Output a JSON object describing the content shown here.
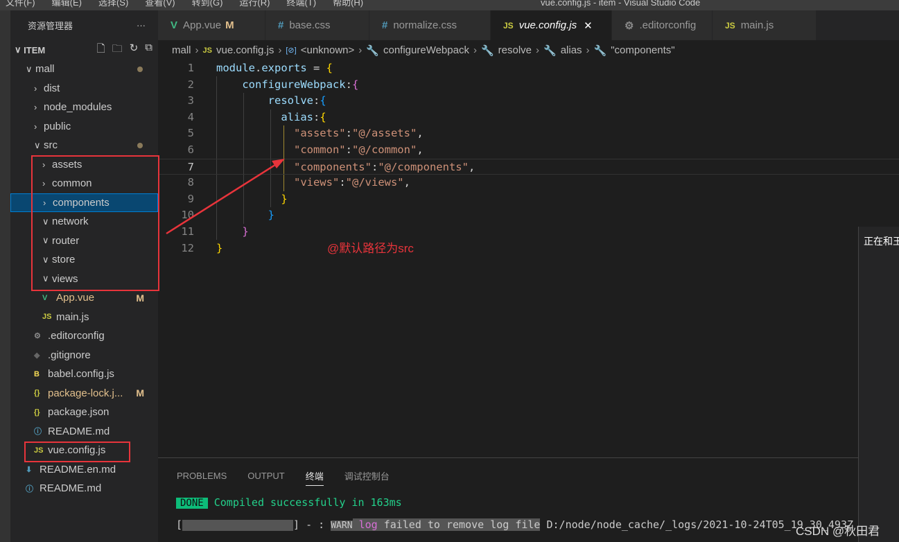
{
  "menubar": {
    "items": [
      "文件(F)",
      "编辑(E)",
      "选择(S)",
      "查看(V)",
      "转到(G)",
      "运行(R)",
      "终端(T)",
      "帮助(H)"
    ],
    "title": "vue.config.js - item - Visual Studio Code"
  },
  "sidebar": {
    "title": "资源管理器",
    "more": "···",
    "root": "ITEM",
    "items": [
      {
        "label": "mall",
        "type": "folder-open",
        "indent": 0,
        "dot": true
      },
      {
        "label": "dist",
        "type": "folder",
        "indent": 1
      },
      {
        "label": "node_modules",
        "type": "folder",
        "indent": 1
      },
      {
        "label": "public",
        "type": "folder",
        "indent": 1
      },
      {
        "label": "src",
        "type": "folder-open",
        "indent": 1,
        "dot": true
      },
      {
        "label": "assets",
        "type": "folder",
        "indent": 2
      },
      {
        "label": "common",
        "type": "folder",
        "indent": 2
      },
      {
        "label": "components",
        "type": "folder",
        "indent": 2,
        "selected": true
      },
      {
        "label": "network",
        "type": "folder-open",
        "indent": 2
      },
      {
        "label": "router",
        "type": "folder-open",
        "indent": 2
      },
      {
        "label": "store",
        "type": "folder-open",
        "indent": 2
      },
      {
        "label": "views",
        "type": "folder-open",
        "indent": 2
      },
      {
        "label": "App.vue",
        "type": "vue",
        "indent": 2,
        "badge": "M"
      },
      {
        "label": "main.js",
        "type": "js",
        "indent": 2
      },
      {
        "label": ".editorconfig",
        "type": "gear",
        "indent": 1
      },
      {
        "label": ".gitignore",
        "type": "git",
        "indent": 1
      },
      {
        "label": "babel.config.js",
        "type": "babel",
        "indent": 1
      },
      {
        "label": "package-lock.j...",
        "type": "json",
        "indent": 1,
        "badge": "M"
      },
      {
        "label": "package.json",
        "type": "json",
        "indent": 1
      },
      {
        "label": "README.md",
        "type": "info",
        "indent": 1
      },
      {
        "label": "vue.config.js",
        "type": "js",
        "indent": 1
      },
      {
        "label": "README.en.md",
        "type": "download",
        "indent": 0
      },
      {
        "label": "README.md",
        "type": "info",
        "indent": 0
      }
    ]
  },
  "tabs": [
    {
      "label": "App.vue",
      "icon": "V",
      "badge": "M",
      "color": "#41b883"
    },
    {
      "label": "base.css",
      "icon": "#",
      "color": "#519aba"
    },
    {
      "label": "normalize.css",
      "icon": "#",
      "color": "#519aba"
    },
    {
      "label": "vue.config.js",
      "icon": "JS",
      "active": true,
      "close": "✕",
      "color": "#cbcb41"
    },
    {
      "label": ".editorconfig",
      "icon": "⚙",
      "color": "#888"
    },
    {
      "label": "main.js",
      "icon": "JS",
      "color": "#cbcb41"
    }
  ],
  "breadcrumb": [
    "mall",
    "vue.config.js",
    "<unknown>",
    "configureWebpack",
    "resolve",
    "alias",
    "\"components\""
  ],
  "code": {
    "current_line": 7,
    "lines": [
      [
        [
          "k",
          "module"
        ],
        [
          "p",
          "."
        ],
        [
          "k",
          "exports"
        ],
        [
          "p",
          " = "
        ],
        [
          "y",
          "{"
        ]
      ],
      [
        [
          "p",
          "    "
        ],
        [
          "k",
          "configureWebpack"
        ],
        [
          "p",
          ":"
        ],
        [
          "m",
          "{"
        ]
      ],
      [
        [
          "p",
          "        "
        ],
        [
          "k",
          "resolve"
        ],
        [
          "p",
          ":"
        ],
        [
          "b",
          "{"
        ]
      ],
      [
        [
          "p",
          "          "
        ],
        [
          "k",
          "alias"
        ],
        [
          "p",
          ":"
        ],
        [
          "y",
          "{"
        ]
      ],
      [
        [
          "p",
          "            "
        ],
        [
          "s",
          "\"assets\""
        ],
        [
          "p",
          ":"
        ],
        [
          "s",
          "\"@/assets\""
        ],
        [
          "p",
          ","
        ]
      ],
      [
        [
          "p",
          "            "
        ],
        [
          "s",
          "\"common\""
        ],
        [
          "p",
          ":"
        ],
        [
          "s",
          "\"@/common\""
        ],
        [
          "p",
          ","
        ]
      ],
      [
        [
          "p",
          "            "
        ],
        [
          "s",
          "\"components\""
        ],
        [
          "p",
          ":"
        ],
        [
          "s",
          "\"@/components\""
        ],
        [
          "p",
          ","
        ]
      ],
      [
        [
          "p",
          "            "
        ],
        [
          "s",
          "\"views\""
        ],
        [
          "p",
          ":"
        ],
        [
          "s",
          "\"@/views\""
        ],
        [
          "p",
          ","
        ]
      ],
      [
        [
          "p",
          "          "
        ],
        [
          "y",
          "}"
        ]
      ],
      [
        [
          "p",
          "        "
        ],
        [
          "b",
          "}"
        ]
      ],
      [
        [
          "p",
          "    "
        ],
        [
          "m",
          "}"
        ]
      ],
      [
        [
          "y",
          "}"
        ]
      ]
    ]
  },
  "annotation": "@默认路径为src",
  "panel": {
    "tabs": [
      "PROBLEMS",
      "OUTPUT",
      "终端",
      "调试控制台"
    ],
    "active": 2,
    "done": "DONE",
    "compiled": "Compiled successfully in 163ms",
    "log": {
      "open": "[",
      "close": "] - :",
      "warn": "WARN",
      "log": "log",
      "msg": "failed to remove log file",
      "path": "D:/node/node_cache/_logs/2021-10-24T05_19_30_493Z"
    }
  },
  "right_panel": "正在和王",
  "watermark": "CSDN @秋田君"
}
